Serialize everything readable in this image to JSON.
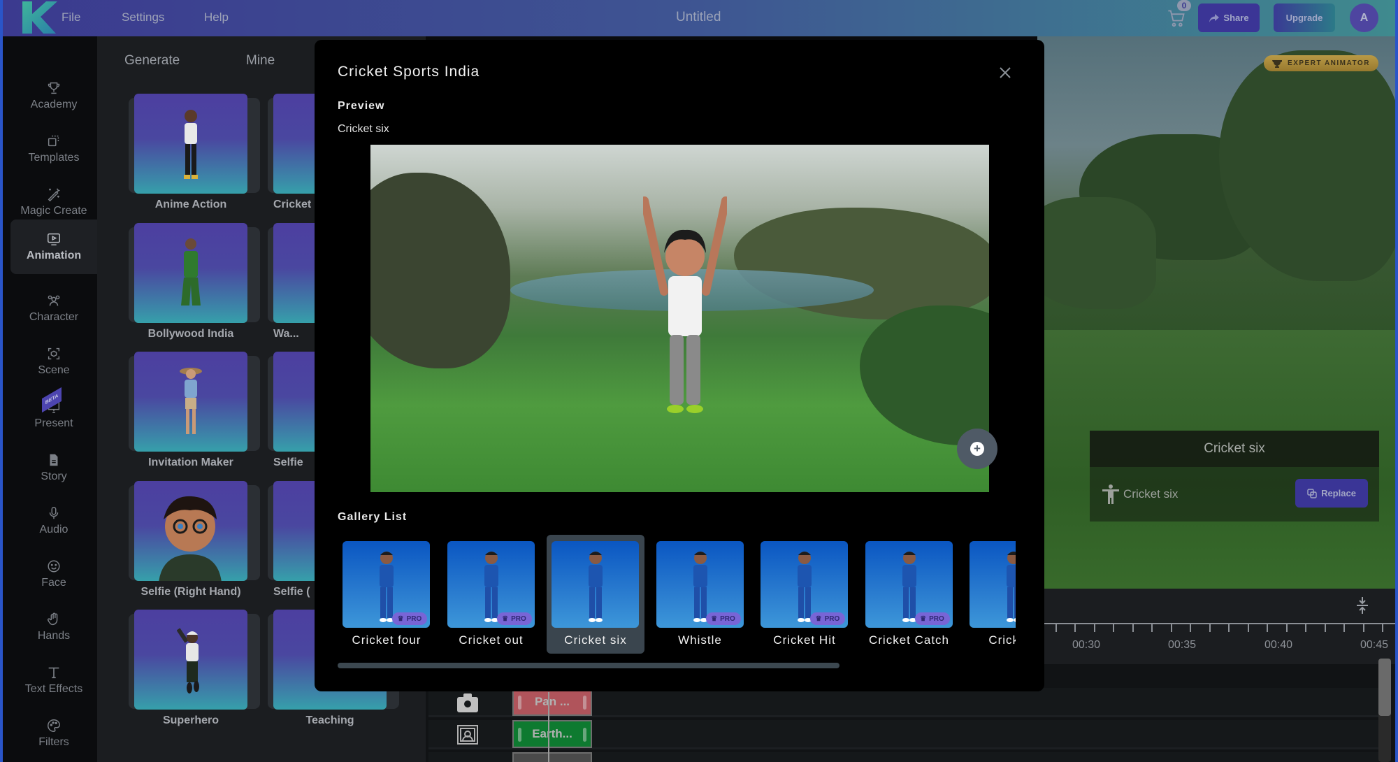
{
  "topbar": {
    "menu": [
      "File",
      "Settings",
      "Help"
    ],
    "title": "Untitled",
    "cart_count": "0",
    "share_label": "Share",
    "upgrade_label": "Upgrade",
    "avatar_initial": "A"
  },
  "sidebar": {
    "items": [
      {
        "label": "Academy",
        "icon": "trophy-icon"
      },
      {
        "label": "Templates",
        "icon": "templates-icon"
      },
      {
        "label": "Magic Create",
        "icon": "magic-wand-icon"
      },
      {
        "label": "Animation",
        "icon": "play-screen-icon",
        "active": true
      },
      {
        "label": "Character",
        "icon": "people-icon"
      },
      {
        "label": "Scene",
        "icon": "scene-cube-icon"
      },
      {
        "label": "Present",
        "icon": "presentation-icon",
        "badge": "BETA"
      },
      {
        "label": "Story",
        "icon": "document-icon"
      },
      {
        "label": "Audio",
        "icon": "microphone-icon"
      },
      {
        "label": "Face",
        "icon": "smiley-icon"
      },
      {
        "label": "Hands",
        "icon": "hand-icon"
      },
      {
        "label": "Text Effects",
        "icon": "text-icon"
      },
      {
        "label": "Filters",
        "icon": "palette-icon"
      }
    ]
  },
  "animation_panel": {
    "tabs": [
      "Generate",
      "Mine"
    ],
    "cards": [
      {
        "label": "Anime Action"
      },
      {
        "label": "Cricket Sports India"
      },
      {
        "label": "Bollywood India"
      },
      {
        "label": "Wa..."
      },
      {
        "label": "Invitation Maker"
      },
      {
        "label": "Selfie"
      },
      {
        "label": "Selfie (Right Hand)"
      },
      {
        "label": "Selfie ("
      },
      {
        "label": "Superhero"
      },
      {
        "label": "Teaching"
      }
    ]
  },
  "modal": {
    "title": "Cricket Sports India",
    "preview_label": "Preview",
    "preview_animation": "Cricket six",
    "gallery_label": "Gallery List",
    "gallery": [
      {
        "label": "Cricket four",
        "pro": true
      },
      {
        "label": "Cricket out",
        "pro": true
      },
      {
        "label": "Cricket six",
        "pro": false,
        "selected": true
      },
      {
        "label": "Whistle",
        "pro": true
      },
      {
        "label": "Cricket Hit",
        "pro": true
      },
      {
        "label": "Cricket Catch",
        "pro": true
      },
      {
        "label": "Cricket I",
        "pro": true
      }
    ],
    "pro_label": "PRO"
  },
  "scene_panel": {
    "badge": "EXPERT ANIMATOR",
    "animation_title": "Cricket six",
    "animation_name": "Cricket six",
    "replace_label": "Replace"
  },
  "timeline": {
    "time_labels": [
      "00:30",
      "00:35",
      "00:40",
      "00:45"
    ],
    "clips": [
      {
        "label": "Pan ...",
        "color": "#b0545b",
        "track": "camera"
      },
      {
        "label": "Earth...",
        "color": "#0e7a30",
        "track": "scene"
      }
    ]
  }
}
